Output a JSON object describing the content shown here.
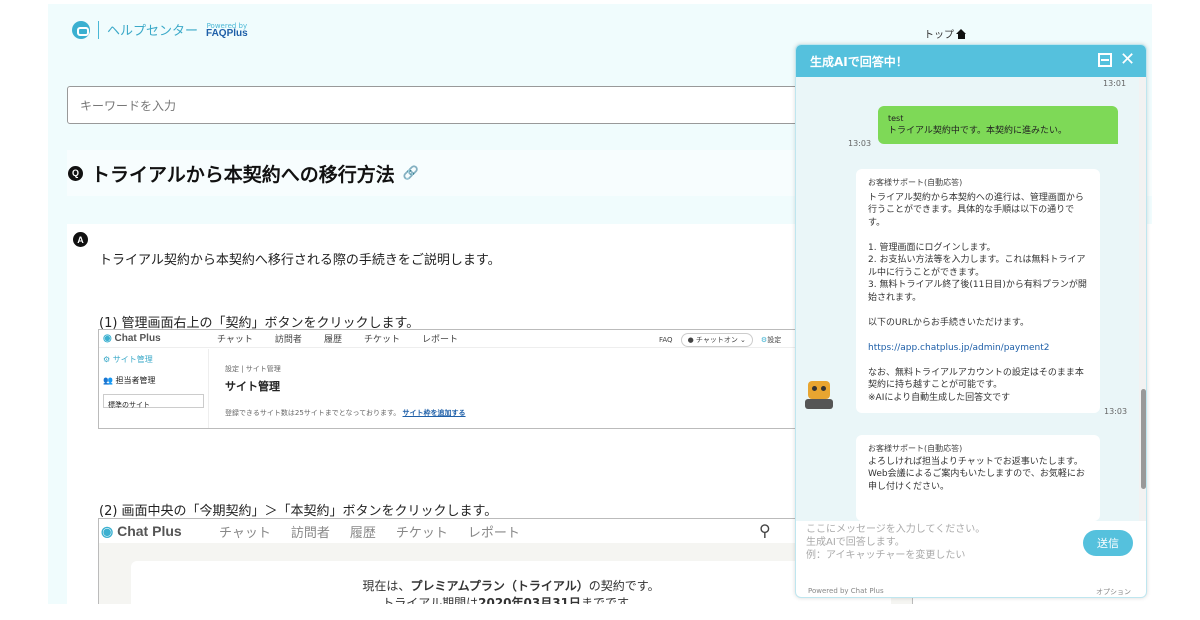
{
  "header": {
    "title": "ヘルプセンター",
    "powered_by": "Powered by",
    "faq_logo": "FAQPlus",
    "top_link": "トップ"
  },
  "search": {
    "placeholder": "キーワードを入力"
  },
  "question": {
    "mark": "Q",
    "title": "トライアルから本契約への移行方法"
  },
  "answer": {
    "mark": "A",
    "intro": "トライアル契約から本契約へ移行される際の手続きをご説明します。",
    "step1": "(1) 管理画面右上の「契約」ボタンをクリックします。",
    "step2": "(2) 画面中央の「今期契約」＞「本契約」ボタンをクリックします。"
  },
  "shot1": {
    "logo": "Chat Plus",
    "nav": [
      "チャット",
      "訪問者",
      "履歴",
      "チケット",
      "レポート"
    ],
    "faq_badge": "FAQ",
    "status_pill": "● チャットオン ⌄",
    "settings": "設定",
    "side_items": [
      "サイト管理",
      "担当者管理"
    ],
    "site_select": "標準のサイト",
    "breadcrumb": "設定 | サイト管理",
    "page_title": "サイト管理",
    "note": "登録できるサイト数は25サイトまでとなっております。",
    "add_link": "サイト枠を追加する"
  },
  "shot2": {
    "logo": "Chat Plus",
    "nav": [
      "チャット",
      "訪問者",
      "履歴",
      "チケット",
      "レポート"
    ],
    "line1_a": "現在は、",
    "line1_b": "プレミアムプラン（トライアル）",
    "line1_c": "の契約です。",
    "line2_a": "トライアル期間は",
    "line2_b": "2020年03月31日",
    "line2_c": "までです。"
  },
  "widget": {
    "title": "生成AIで回答中！",
    "time1": "13:01",
    "user_name": "test",
    "user_msg": "トライアル契約中です。本契約に進みたい。",
    "time2": "13:03",
    "bot_name": "お客様サポート(自動応答)",
    "bot_msg_1": "トライアル契約から本契約への進行は、管理画面から行うことができます。具体的な手順は以下の通りです。",
    "bot_msg_2": "1. 管理画面にログインします。",
    "bot_msg_3": "2. お支払い方法等を入力します。これは無料トライアル中に行うことができます。",
    "bot_msg_4": "3. 無料トライアル終了後(11日目)から有料プランが開始されます。",
    "bot_msg_5": "以下のURLからお手続きいただけます。",
    "bot_url": "https://app.chatplus.jp/admin/payment2",
    "bot_msg_6": "なお、無料トライアルアカウントの設定はそのまま本契約に持ち越すことが可能です。",
    "bot_msg_7": "※AIにより自動生成した回答文です",
    "time3": "13:03",
    "bot2_name": "お客様サポート(自動応答)",
    "bot2_msg_1": "よろしければ担当よりチャットでお返事いたします。",
    "bot2_msg_2": "Web会議によるご案内もいたしますので、お気軽にお申し付けください。",
    "input_line1": "ここにメッセージを入力してください。",
    "input_line2": "生成AIで回答します。",
    "input_line3": "例：アイキャッチャーを変更したい",
    "send_label": "送信",
    "footer": "Powered by Chat Plus",
    "option": "オプション"
  }
}
